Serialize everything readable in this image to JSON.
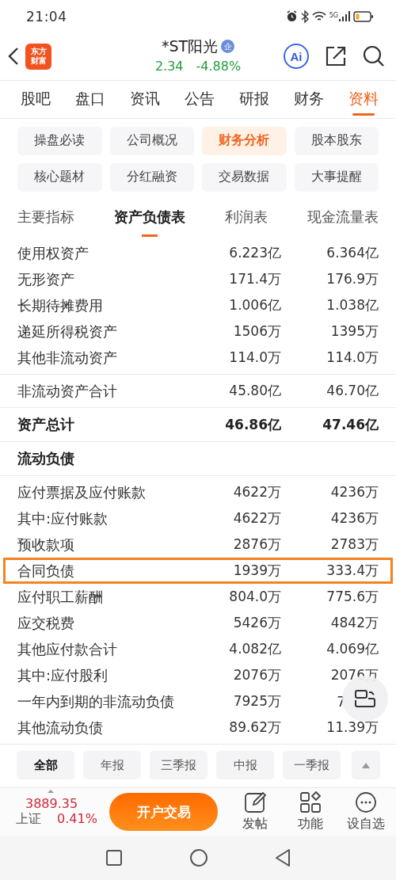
{
  "status_bar": {
    "time": "21:04",
    "network": "5G"
  },
  "header": {
    "logo": [
      "东方",
      "财富"
    ],
    "title": "*ST阳光",
    "badge": "企",
    "price": "2.34",
    "change": "-4.88%",
    "ai_label": "Ai"
  },
  "tabs": [
    {
      "label": "股吧",
      "selected": false
    },
    {
      "label": "盘口",
      "selected": false
    },
    {
      "label": "资讯",
      "selected": false
    },
    {
      "label": "公告",
      "selected": false
    },
    {
      "label": "研报",
      "selected": false
    },
    {
      "label": "财务",
      "selected": false
    },
    {
      "label": "资料",
      "selected": true
    }
  ],
  "sections": [
    {
      "label": "操盘必读",
      "selected": false
    },
    {
      "label": "公司概况",
      "selected": false
    },
    {
      "label": "财务分析",
      "selected": true
    },
    {
      "label": "股本股东",
      "selected": false
    },
    {
      "label": "核心题材",
      "selected": false
    },
    {
      "label": "分红融资",
      "selected": false
    },
    {
      "label": "交易数据",
      "selected": false
    },
    {
      "label": "大事提醒",
      "selected": false
    }
  ],
  "statement_tabs": [
    {
      "label": "主要指标",
      "selected": false
    },
    {
      "label": "资产负债表",
      "selected": true
    },
    {
      "label": "利润表",
      "selected": false
    },
    {
      "label": "现金流量表",
      "selected": false
    }
  ],
  "table": {
    "groups": [
      {
        "rows": [
          {
            "kind": "item",
            "label": "使用权资产",
            "values": [
              "6.223亿",
              "6.364亿"
            ],
            "highlighted": false,
            "covered": false
          },
          {
            "kind": "item",
            "label": "无形资产",
            "values": [
              "171.4万",
              "176.9万"
            ],
            "highlighted": false,
            "covered": false
          },
          {
            "kind": "item",
            "label": "长期待摊费用",
            "values": [
              "1.006亿",
              "1.038亿"
            ],
            "highlighted": false,
            "covered": false
          },
          {
            "kind": "item",
            "label": "递延所得税资产",
            "values": [
              "1506万",
              "1395万"
            ],
            "highlighted": false,
            "covered": false
          },
          {
            "kind": "item",
            "label": "其他非流动资产",
            "values": [
              "114.0万",
              "114.0万"
            ],
            "highlighted": false,
            "covered": false
          }
        ]
      },
      {
        "rows": [
          {
            "kind": "item",
            "label": "非流动资产合计",
            "values": [
              "45.80亿",
              "46.70亿"
            ],
            "highlighted": false,
            "covered": false
          }
        ]
      },
      {
        "rows": [
          {
            "kind": "total",
            "label": "资产总计",
            "values": [
              "46.86亿",
              "47.46亿"
            ],
            "highlighted": false,
            "covered": false
          }
        ]
      },
      {
        "rows": [
          {
            "kind": "section",
            "label": "流动负债",
            "highlighted": false
          }
        ]
      },
      {
        "rows": [
          {
            "kind": "item",
            "label": "应付票据及应付账款",
            "values": [
              "4622万",
              "4236万"
            ],
            "highlighted": false,
            "covered": false
          },
          {
            "kind": "item",
            "label": "其中:应付账款",
            "values": [
              "4622万",
              "4236万"
            ],
            "highlighted": false,
            "covered": false
          },
          {
            "kind": "item",
            "label": "预收款项",
            "values": [
              "2876万",
              "2783万"
            ],
            "highlighted": false,
            "covered": false
          },
          {
            "kind": "item",
            "label": "合同负债",
            "values": [
              "1939万",
              "333.4万"
            ],
            "highlighted": true,
            "covered": false
          },
          {
            "kind": "item",
            "label": "应付职工薪酬",
            "values": [
              "804.0万",
              "775.6万"
            ],
            "highlighted": false,
            "covered": false
          },
          {
            "kind": "item",
            "label": "应交税费",
            "values": [
              "5426万",
              "4842万"
            ],
            "highlighted": false,
            "covered": false
          },
          {
            "kind": "item",
            "label": "其他应付款合计",
            "values": [
              "4.082亿",
              "4.069亿"
            ],
            "highlighted": false,
            "covered": false
          },
          {
            "kind": "item",
            "label": "其中:应付股利",
            "values": [
              "2076万",
              "2076万"
            ],
            "highlighted": false,
            "covered": false
          },
          {
            "kind": "item",
            "label": "一年内到期的非流动负债",
            "values": [
              "7925万",
              "7"
            ],
            "highlighted": false,
            "covered": true
          },
          {
            "kind": "item",
            "label": "其他流动负债",
            "values": [
              "89.62万",
              "11.39万"
            ],
            "highlighted": false,
            "covered": false
          }
        ]
      }
    ]
  },
  "periods": [
    {
      "label": "全部",
      "selected": true
    },
    {
      "label": "年报",
      "selected": false
    },
    {
      "label": "三季报",
      "selected": false
    },
    {
      "label": "中报",
      "selected": false
    },
    {
      "label": "一季报",
      "selected": false
    }
  ],
  "bottom_bar": {
    "index_value": "3889.35",
    "index_name": "上证",
    "index_change": "0.41%",
    "trade_button": "开户交易",
    "actions": [
      {
        "label": "发帖"
      },
      {
        "label": "功能"
      },
      {
        "label": "设自选"
      }
    ]
  }
}
